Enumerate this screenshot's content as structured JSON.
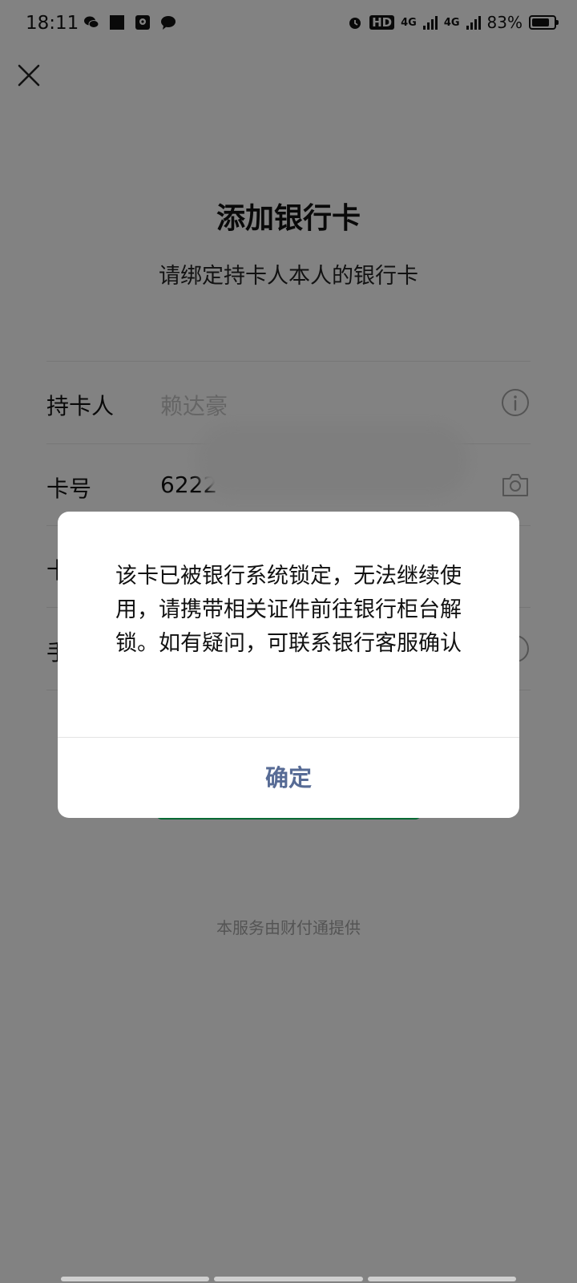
{
  "status_bar": {
    "time": "18:11",
    "hd_label": "HD",
    "network_1": "4G",
    "network_2": "4G",
    "battery": "83%",
    "battery_level": 0.83
  },
  "page": {
    "title": "添加银行卡",
    "subtitle": "请绑定持卡人本人的银行卡"
  },
  "form": {
    "cardholder_label": "持卡人",
    "cardholder_value": "赖达豪",
    "card_number_label": "卡号",
    "card_number_value": "6222",
    "row3_label": "卡",
    "row4_label": "手"
  },
  "footer": {
    "note": "本服务由财付通提供"
  },
  "dialog": {
    "message": "该卡已被银行系统锁定，无法继续使用，请携带相关证件前往银行柜台解锁。如有疑问，可联系银行客服确认",
    "confirm_label": "确定",
    "confirm_color": "#576b95"
  },
  "colors": {
    "accent_green": "#07c160"
  },
  "icons": {
    "close": "close-icon",
    "info": "info-icon",
    "camera": "camera-icon"
  }
}
